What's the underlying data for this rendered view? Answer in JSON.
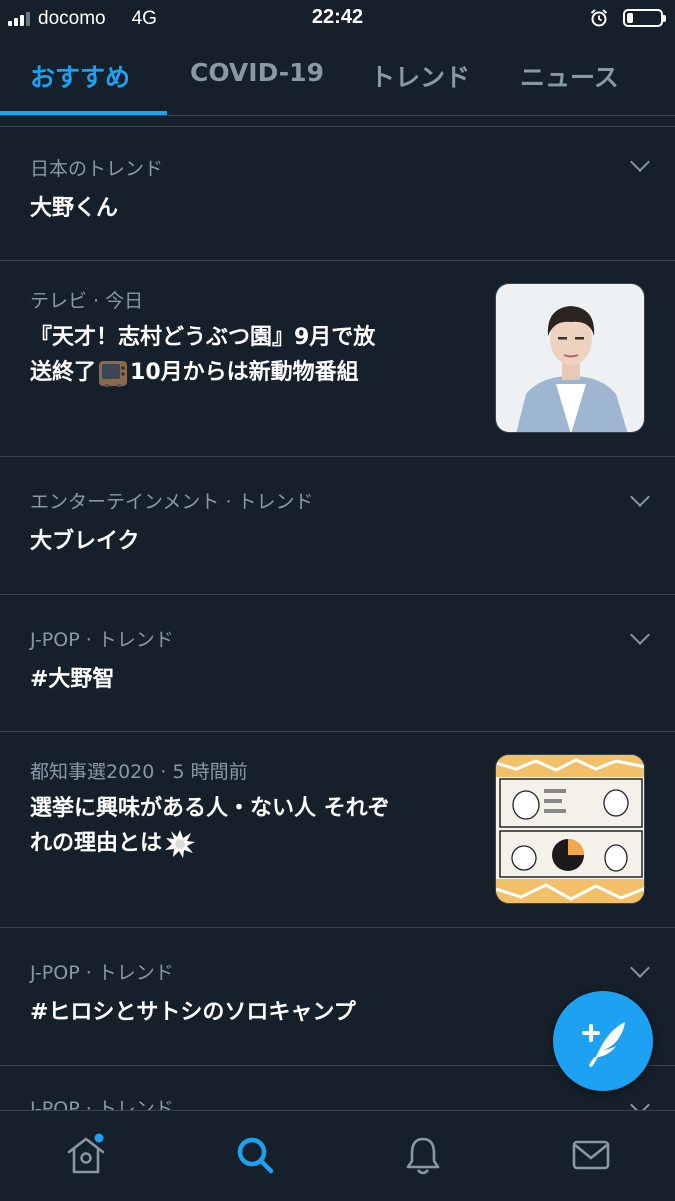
{
  "status_bar": {
    "carrier": "docomo",
    "network": "4G",
    "time": "22:42",
    "signal_bars": 4,
    "signal_bars_filled": 3,
    "battery_level": 0.2,
    "icons": [
      "signal-icon",
      "alarm-icon",
      "battery-icon"
    ]
  },
  "tabs": [
    {
      "label": "おすすめ",
      "active": true
    },
    {
      "label": "COVID-19",
      "active": false
    },
    {
      "label": "トレンド",
      "active": false
    },
    {
      "label": "ニュース",
      "active": false
    }
  ],
  "trends": [
    {
      "meta": "日本のトレンド",
      "title": "大野くん",
      "has_chevron": true
    },
    {
      "meta": "テレビ · 今日",
      "title_line1": "『天才！志村どうぶつ園』9月で放",
      "title_line2_pre": "送終了",
      "title_emoji_icon": "tv-icon",
      "title_line2_post": "10月からは新動物番組",
      "thumbnail_icon": "person-photo"
    },
    {
      "meta": "エンターテインメント · トレンド",
      "title": "大ブレイク",
      "has_chevron": true
    },
    {
      "meta": "J-POP · トレンド",
      "title": "#大野智",
      "has_chevron": true
    },
    {
      "meta": "都知事選2020 · 5 時間前",
      "title_line1": "選挙に興味がある人・ない人 それぞ",
      "title_line2_pre": "れの理由とは",
      "title_emoji_icon": "anger-burst-icon",
      "thumbnail_icon": "manga-photo"
    },
    {
      "meta": "J-POP · トレンド",
      "title": "#ヒロシとサトシのソロキャンプ",
      "has_chevron": true
    },
    {
      "meta": "J-POP · トレンド",
      "has_chevron": true
    }
  ],
  "bottom_nav": [
    {
      "icon": "home-icon",
      "has_notification_dot": true,
      "active": false
    },
    {
      "icon": "search-icon",
      "active": true
    },
    {
      "icon": "bell-icon",
      "active": false
    },
    {
      "icon": "mail-icon",
      "active": false
    }
  ],
  "fab": {
    "icon": "compose-tweet-icon"
  },
  "colors": {
    "background": "#15202b",
    "accent": "#1da1f2",
    "muted_text": "#8899a6",
    "divider": "#38444d"
  }
}
